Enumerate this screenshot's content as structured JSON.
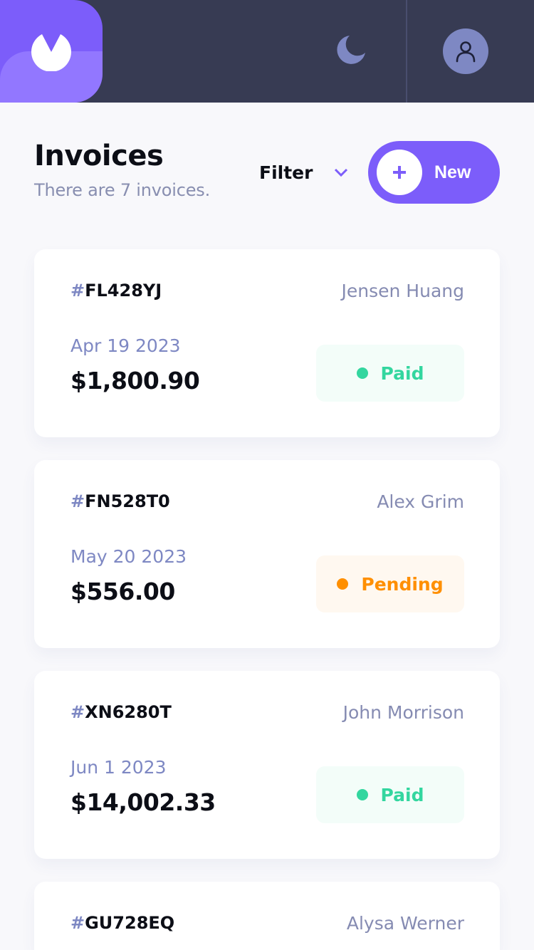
{
  "header": {
    "logo_icon": "app-logo",
    "theme_icon": "moon-icon",
    "avatar_icon": "user-icon"
  },
  "page": {
    "title": "Invoices",
    "subtitle": "There are 7 invoices.",
    "filter_label": "Filter",
    "new_label": "New"
  },
  "invoices": [
    {
      "hash": "#",
      "id": "FL428YJ",
      "client": "Jensen Huang",
      "due": "Apr 19 2023",
      "amount": "$1,800.90",
      "status": "Paid",
      "status_key": "paid"
    },
    {
      "hash": "#",
      "id": "FN528T0",
      "client": "Alex Grim",
      "due": "May 20 2023",
      "amount": "$556.00",
      "status": "Pending",
      "status_key": "pending"
    },
    {
      "hash": "#",
      "id": "XN6280T",
      "client": "John Morrison",
      "due": "Jun 1 2023",
      "amount": "$14,002.33",
      "status": "Paid",
      "status_key": "paid"
    },
    {
      "hash": "#",
      "id": "GU728EQ",
      "client": "Alysa Werner",
      "due": "",
      "amount": "",
      "status": "",
      "status_key": ""
    }
  ],
  "colors": {
    "header_bg": "#373B53",
    "accent": "#7C5DFA",
    "paid": "#33D69F",
    "pending": "#FF8F00"
  }
}
